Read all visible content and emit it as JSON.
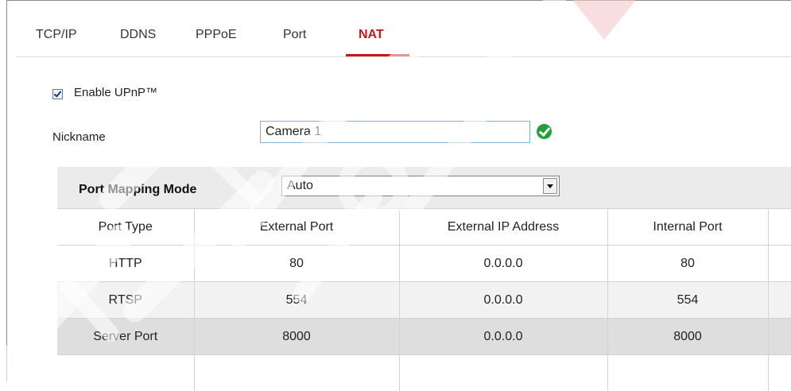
{
  "tabs": [
    {
      "label": "TCP/IP",
      "active": false
    },
    {
      "label": "DDNS",
      "active": false
    },
    {
      "label": "PPPoE",
      "active": false
    },
    {
      "label": "Port",
      "active": false
    },
    {
      "label": "NAT",
      "active": true
    }
  ],
  "upnp": {
    "label": "Enable UPnP™",
    "checked": true
  },
  "nickname": {
    "label": "Nickname",
    "value": "Camera 1",
    "valid_icon": "check-circle-icon"
  },
  "port_mapping": {
    "label": "Port Mapping Mode",
    "selected": "Auto"
  },
  "table": {
    "headers": [
      "Port Type",
      "External Port",
      "External IP Address",
      "Internal Port",
      ""
    ],
    "rows": [
      [
        "HTTP",
        "80",
        "0.0.0.0",
        "80",
        ""
      ],
      [
        "RTSP",
        "554",
        "0.0.0.0",
        "554",
        ""
      ],
      [
        "Server Port",
        "8000",
        "0.0.0.0",
        "8000",
        ""
      ],
      [
        "",
        "",
        "",
        "",
        ""
      ]
    ]
  },
  "colors": {
    "active_tab": "#c8161d",
    "valid_icon": "#21a03a",
    "watermark": "#ffffff"
  }
}
